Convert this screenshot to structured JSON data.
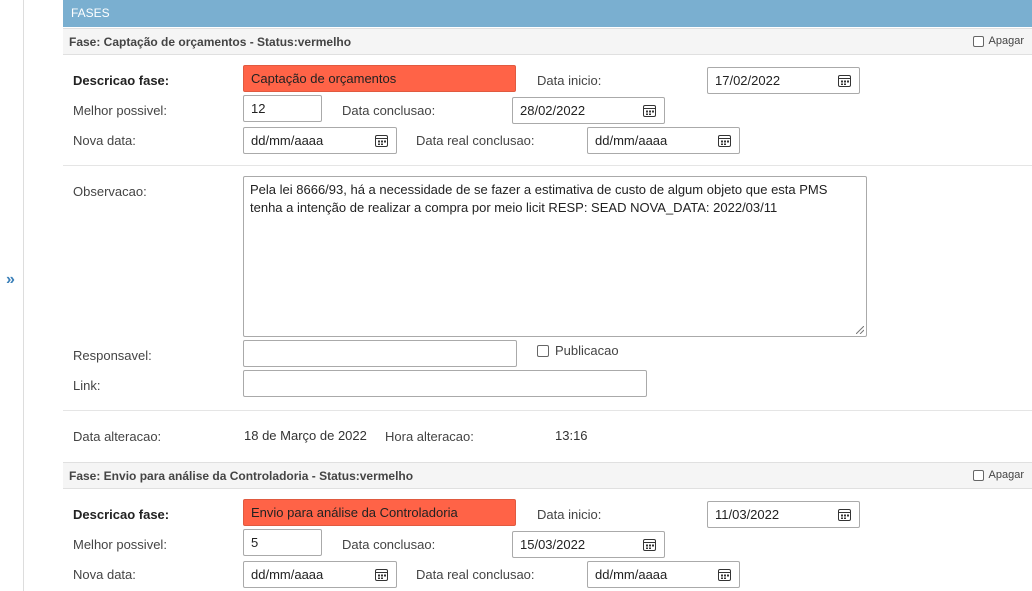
{
  "section_header": "FASES",
  "sidebar": {
    "expand_glyph": "»"
  },
  "labels": {
    "descricao": "Descricao fase:",
    "melhor": "Melhor possivel:",
    "nova": "Nova data:",
    "data_inicio": "Data inicio:",
    "data_conclusao": "Data conclusao:",
    "data_real": "Data real conclusao:",
    "observacao": "Observacao:",
    "responsavel": "Responsavel:",
    "link": "Link:",
    "publicacao": "Publicacao",
    "data_alteracao": "Data alteracao:",
    "hora_alteracao": "Hora alteracao:",
    "apagar": "Apagar"
  },
  "phases": [
    {
      "title": "Fase: Captação de orçamentos - Status:vermelho",
      "descricao": "Captação de orçamentos",
      "melhor": "12",
      "data_inicio": "17/02/2022",
      "data_conclusao": "28/02/2022",
      "nova_data": "dd/mm/aaaa",
      "data_real": "dd/mm/aaaa",
      "observacao": "Pela lei 8666/93, há a necessidade de se fazer a estimativa de custo de algum objeto que esta PMS tenha a intenção de realizar a compra por meio licit RESP: SEAD NOVA_DATA: 2022/03/11",
      "responsavel": "",
      "link": "",
      "data_alteracao": "18 de Março de 2022",
      "hora_alteracao": "13:16"
    },
    {
      "title": "Fase: Envio para análise da Controladoria - Status:vermelho",
      "descricao": "Envio para análise da Controladoria",
      "melhor": "5",
      "data_inicio": "11/03/2022",
      "data_conclusao": "15/03/2022",
      "nova_data": "dd/mm/aaaa",
      "data_real": "dd/mm/aaaa"
    }
  ],
  "colors": {
    "header": "#7aafd0",
    "status_red": "#ff6347",
    "expand": "#3a7fb8"
  },
  "icons": {
    "date_picker": "calendar-icon",
    "checkbox": "checkbox-icon",
    "resize": "resize-handle-icon"
  }
}
